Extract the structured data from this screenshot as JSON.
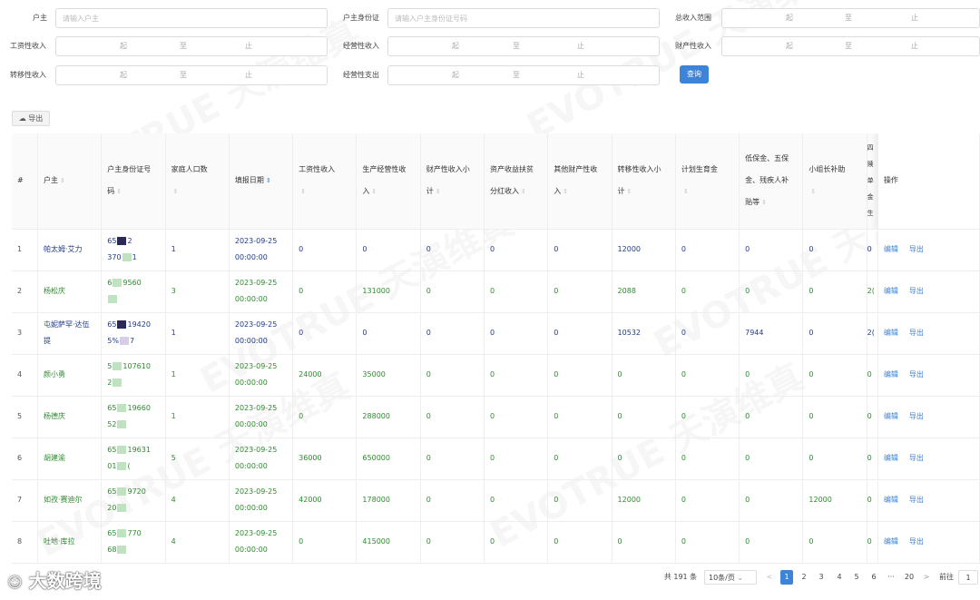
{
  "filters": {
    "owner_label": "户主",
    "owner_placeholder": "请输入户主",
    "owner_id_label": "户主身份证",
    "owner_id_placeholder": "请输入户主身份证号码",
    "total_income_label": "总收入范围",
    "wage_label": "工资性收入",
    "business_label": "经营性收入",
    "property_label": "财产性收入",
    "transfer_label": "转移性收入",
    "business_expense_label": "经营性支出",
    "range_from": "起",
    "range_sep": "至",
    "range_to": "止",
    "query_button": "查询"
  },
  "toolbar": {
    "export_label": "导出"
  },
  "table": {
    "headers": {
      "index": "#",
      "owner": "户主",
      "id_line1": "户主身份证号",
      "id_line2": "码",
      "family": "家庭人口数",
      "date": "填报日期",
      "wage": "工资性收入",
      "biz1": "生产经营性收",
      "biz2": "入",
      "prop1": "财产性收入小",
      "prop2": "计",
      "asset1": "资产收益扶贫",
      "asset2": "分红收入",
      "otherprop1": "其他财产性收",
      "otherprop2": "入",
      "transfer1": "转移性收入小",
      "transfer2": "计",
      "plan": "计划生育金",
      "welfare1": "低保金、五保",
      "welfare2": "金、残疾人补",
      "welfare3": "贴等",
      "leader": "小组长补助",
      "ecol1": "四",
      "ecol2": "赎",
      "ecol3": "单",
      "ecol4": "金",
      "ecol5": "生",
      "ops": "操作"
    },
    "actions": {
      "edit": "编辑",
      "export": "导出"
    },
    "rows": [
      {
        "idx": "1",
        "owner": "帕太姆·艾力",
        "id_a": "65",
        "id_b": "2",
        "id_c": "370",
        "id_d": "1",
        "family": "1",
        "date1": "2023-09-25",
        "date2": "00:00:00",
        "wage": "0",
        "biz": "0",
        "prop": "0",
        "asset": "0",
        "otherprop": "0",
        "transfer": "12000",
        "plan": "0",
        "welfare": "0",
        "leader": "0",
        "extra": "0"
      },
      {
        "idx": "2",
        "owner": "杨松庆",
        "id_a": "6",
        "id_b": "9560",
        "id_c": "",
        "id_d": "",
        "family": "3",
        "date1": "2023-09-25",
        "date2": "00:00:00",
        "wage": "0",
        "biz": "131000",
        "prop": "0",
        "asset": "0",
        "otherprop": "0",
        "transfer": "2088",
        "plan": "0",
        "welfare": "0",
        "leader": "0",
        "extra": "2("
      },
      {
        "idx": "3",
        "owner": "屯妮萨罕·达伍提",
        "owner_l1": "屯妮萨罕·达伍",
        "owner_l2": "提",
        "id_a": "65",
        "id_b": "19420",
        "id_c": "5%",
        "id_d": "7",
        "family": "1",
        "date1": "2023-09-25",
        "date2": "00:00:00",
        "wage": "0",
        "biz": "0",
        "prop": "0",
        "asset": "0",
        "otherprop": "0",
        "transfer": "10532",
        "plan": "0",
        "welfare": "7944",
        "leader": "0",
        "extra": "2("
      },
      {
        "idx": "4",
        "owner": "颜小勇",
        "id_a": "5",
        "id_b": "107610",
        "id_c": "2",
        "id_d": "",
        "family": "1",
        "date1": "2023-09-25",
        "date2": "00:00:00",
        "wage": "24000",
        "biz": "35000",
        "prop": "0",
        "asset": "0",
        "otherprop": "0",
        "transfer": "0",
        "plan": "0",
        "welfare": "0",
        "leader": "0",
        "extra": "0"
      },
      {
        "idx": "5",
        "owner": "杨德庆",
        "id_a": "65",
        "id_b": "19660",
        "id_c": "52",
        "id_d": "",
        "family": "1",
        "date1": "2023-09-25",
        "date2": "00:00:00",
        "wage": "0",
        "biz": "288000",
        "prop": "0",
        "asset": "0",
        "otherprop": "0",
        "transfer": "0",
        "plan": "0",
        "welfare": "0",
        "leader": "0",
        "extra": "0"
      },
      {
        "idx": "6",
        "owner": "胡建渝",
        "id_a": "65",
        "id_b": "19631",
        "id_c": "01",
        "id_d": "(",
        "family": "5",
        "date1": "2023-09-25",
        "date2": "00:00:00",
        "wage": "36000",
        "biz": "650000",
        "prop": "0",
        "asset": "0",
        "otherprop": "0",
        "transfer": "0",
        "plan": "0",
        "welfare": "0",
        "leader": "0",
        "extra": "0"
      },
      {
        "idx": "7",
        "owner": "如孜·赛迪尔",
        "id_a": "65",
        "id_b": "9720",
        "id_c": "20",
        "id_d": "",
        "family": "4",
        "date1": "2023-09-25",
        "date2": "00:00:00",
        "wage": "42000",
        "biz": "178000",
        "prop": "0",
        "asset": "0",
        "otherprop": "0",
        "transfer": "12000",
        "plan": "0",
        "welfare": "0",
        "leader": "12000",
        "extra": "0"
      },
      {
        "idx": "8",
        "owner": "吐地·库拉",
        "id_a": "65",
        "id_b": "770",
        "id_c": "68",
        "id_d": "",
        "family": "4",
        "date1": "2023-09-25",
        "date2": "00:00:00",
        "wage": "0",
        "biz": "415000",
        "prop": "0",
        "asset": "0",
        "otherprop": "0",
        "transfer": "0",
        "plan": "0",
        "welfare": "0",
        "leader": "0",
        "extra": "0"
      }
    ]
  },
  "pagination": {
    "total": "共 191 条",
    "page_size": "10条/页",
    "prev": "<",
    "pages": [
      "1",
      "2",
      "3",
      "4",
      "5",
      "6"
    ],
    "ellipsis": "···",
    "last": "20",
    "next": ">",
    "goto_label": "前往",
    "goto_value": "1",
    "current": "1"
  },
  "logo_text": "大数跨境",
  "watermark_text": "EVOTRUE 天演维真",
  "colors": {
    "accent": "#3d84d8",
    "green_text": "#2e8b2e",
    "blue_text": "#1f3b8a"
  }
}
